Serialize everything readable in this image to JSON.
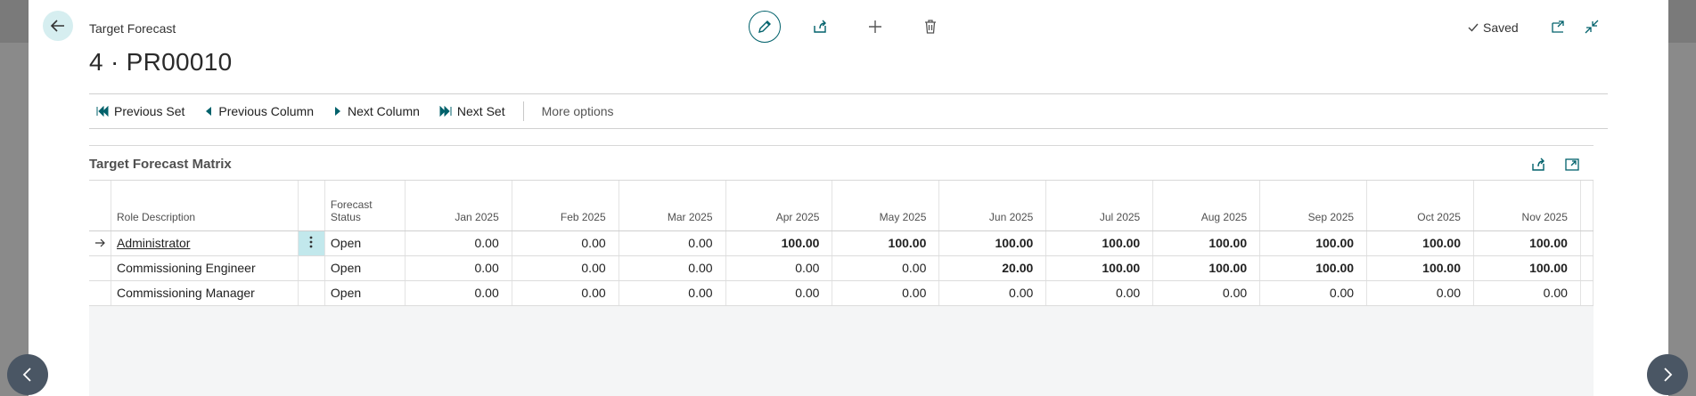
{
  "header": {
    "breadcrumb": "Target Forecast",
    "record_title": "4 · PR00010",
    "saved_label": "Saved"
  },
  "actions": {
    "previous_set": "Previous Set",
    "previous_column": "Previous Column",
    "next_column": "Next Column",
    "next_set": "Next Set",
    "more_options": "More options"
  },
  "matrix": {
    "title": "Target Forecast Matrix",
    "columns": {
      "role_description": "Role Description",
      "forecast_status_line1": "Forecast",
      "forecast_status_line2": "Status",
      "months": [
        "Jan 2025",
        "Feb 2025",
        "Mar 2025",
        "Apr 2025",
        "May 2025",
        "Jun 2025",
        "Jul 2025",
        "Aug 2025",
        "Sep 2025",
        "Oct 2025",
        "Nov 2025"
      ]
    },
    "rows": [
      {
        "role": "Administrator",
        "status": "Open",
        "values": [
          "0.00",
          "0.00",
          "0.00",
          "100.00",
          "100.00",
          "100.00",
          "100.00",
          "100.00",
          "100.00",
          "100.00",
          "100.00"
        ]
      },
      {
        "role": "Commissioning Engineer",
        "status": "Open",
        "values": [
          "0.00",
          "0.00",
          "0.00",
          "0.00",
          "0.00",
          "20.00",
          "100.00",
          "100.00",
          "100.00",
          "100.00",
          "100.00"
        ]
      },
      {
        "role": "Commissioning Manager",
        "status": "Open",
        "values": [
          "0.00",
          "0.00",
          "0.00",
          "0.00",
          "0.00",
          "0.00",
          "0.00",
          "0.00",
          "0.00",
          "0.00",
          "0.00"
        ]
      }
    ]
  },
  "colors": {
    "accent": "#00616b",
    "selected_cell": "#c2e8ec",
    "nav_button": "#4a5664"
  }
}
